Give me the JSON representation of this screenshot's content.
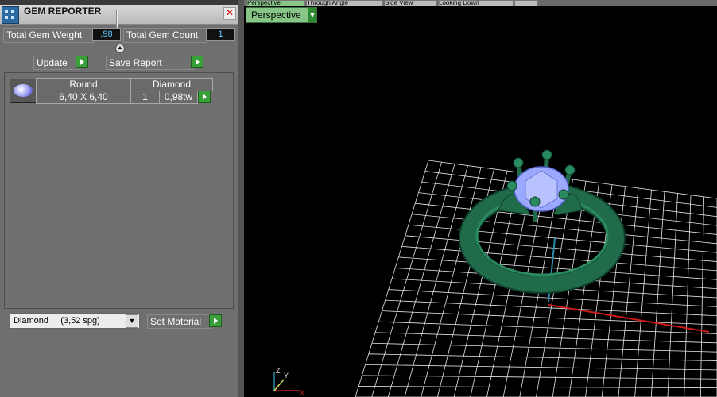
{
  "window": {
    "title": "GEM REPORTER",
    "close": "✕"
  },
  "totals": {
    "weight_label": "Total Gem Weight",
    "weight_value": ",98",
    "count_label": "Total Gem Count",
    "count_value": "1"
  },
  "actions": {
    "update": "Update",
    "save_report": "Save Report"
  },
  "gem_table": {
    "headers": {
      "shape": "Round",
      "material": "Diamond"
    },
    "row": {
      "size": "6,40 X 6,40",
      "count": "1",
      "weight": "0,98tw"
    }
  },
  "material": {
    "selected": "Diamond     (3,52 spg)",
    "set_button": "Set Material"
  },
  "viewport": {
    "tabs": [
      "Perspective",
      "Through Angle",
      "Side View",
      "Looking Down",
      ""
    ],
    "view_label": "Perspective",
    "axis_labels": {
      "z": "Z",
      "y": "Y",
      "x": "X"
    }
  },
  "colors": {
    "ring": "#1f6b4a",
    "gem": "#9aa8ff",
    "grid": "#e6e6e6",
    "x_axis": "#cc1a1a",
    "z_axis": "#2d8aa8",
    "accent_green": "#87c687"
  }
}
